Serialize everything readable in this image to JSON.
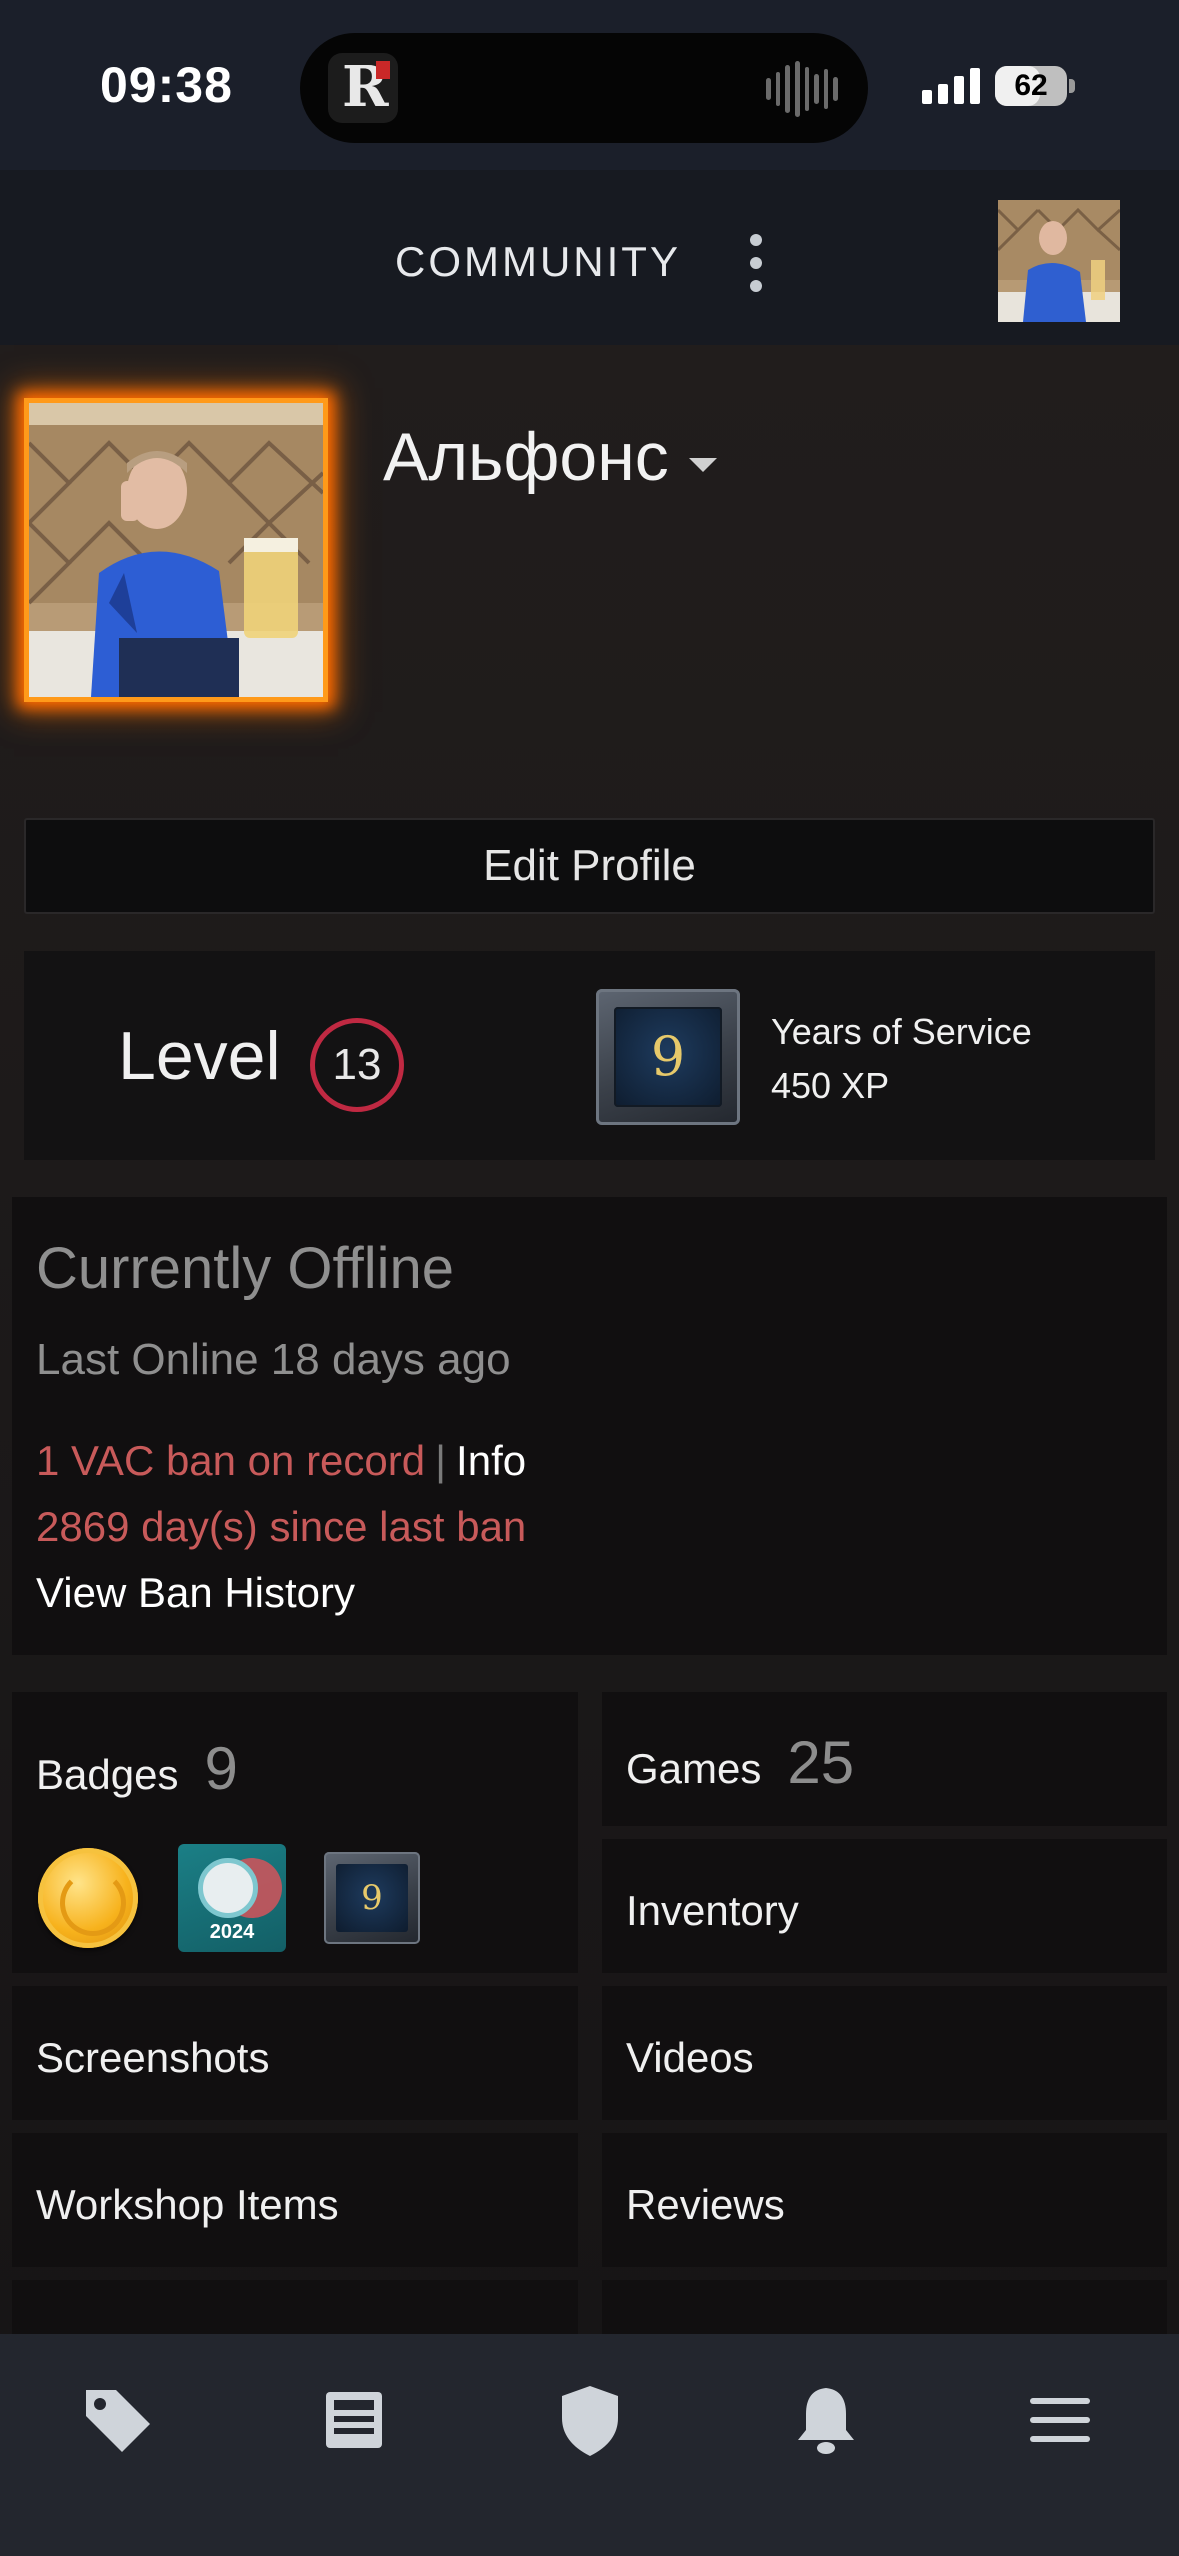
{
  "status_bar": {
    "time": "09:38",
    "battery": "62",
    "battery_fraction": 0.62,
    "island_app_glyph": "R",
    "icons": [
      "signal-icon",
      "battery-icon",
      "audio-wave-icon"
    ]
  },
  "header": {
    "title": "COMMUNITY",
    "menu_icon": "more-vertical-icon"
  },
  "profile": {
    "persona_name": "Альфонс",
    "edit_profile_label": "Edit Profile",
    "frame_color": "#ff8a00"
  },
  "level": {
    "label": "Level",
    "value": "13",
    "badge_number": "9",
    "badge_title": "Years of Service",
    "badge_xp": "450 XP",
    "ring_color": "#c02942"
  },
  "status": {
    "state": "Currently Offline",
    "last_online": "Last Online 18 days ago",
    "vac_text": "1 VAC ban on record",
    "vac_separator": "|",
    "vac_info": "Info",
    "ban_days": "2869 day(s) since last ban",
    "ban_history": "View Ban History",
    "ban_color": "#c85a5a"
  },
  "tiles": {
    "badges_label": "Badges",
    "badges_count": "9",
    "badge_icons": [
      {
        "name": "medal-badge-icon"
      },
      {
        "name": "steam-2024-badge-icon",
        "text": "2024"
      },
      {
        "name": "years-of-service-badge-icon",
        "text": "9"
      }
    ],
    "games_label": "Games",
    "games_count": "25",
    "inventory_label": "Inventory",
    "screenshots_label": "Screenshots",
    "videos_label": "Videos",
    "workshop_label": "Workshop Items",
    "reviews_label": "Reviews"
  },
  "tabbar": {
    "tabs": [
      {
        "icon": "store-tag-icon"
      },
      {
        "icon": "news-icon"
      },
      {
        "icon": "guard-shield-icon"
      },
      {
        "icon": "notifications-bell-icon"
      },
      {
        "icon": "menu-hamburger-icon"
      }
    ]
  }
}
